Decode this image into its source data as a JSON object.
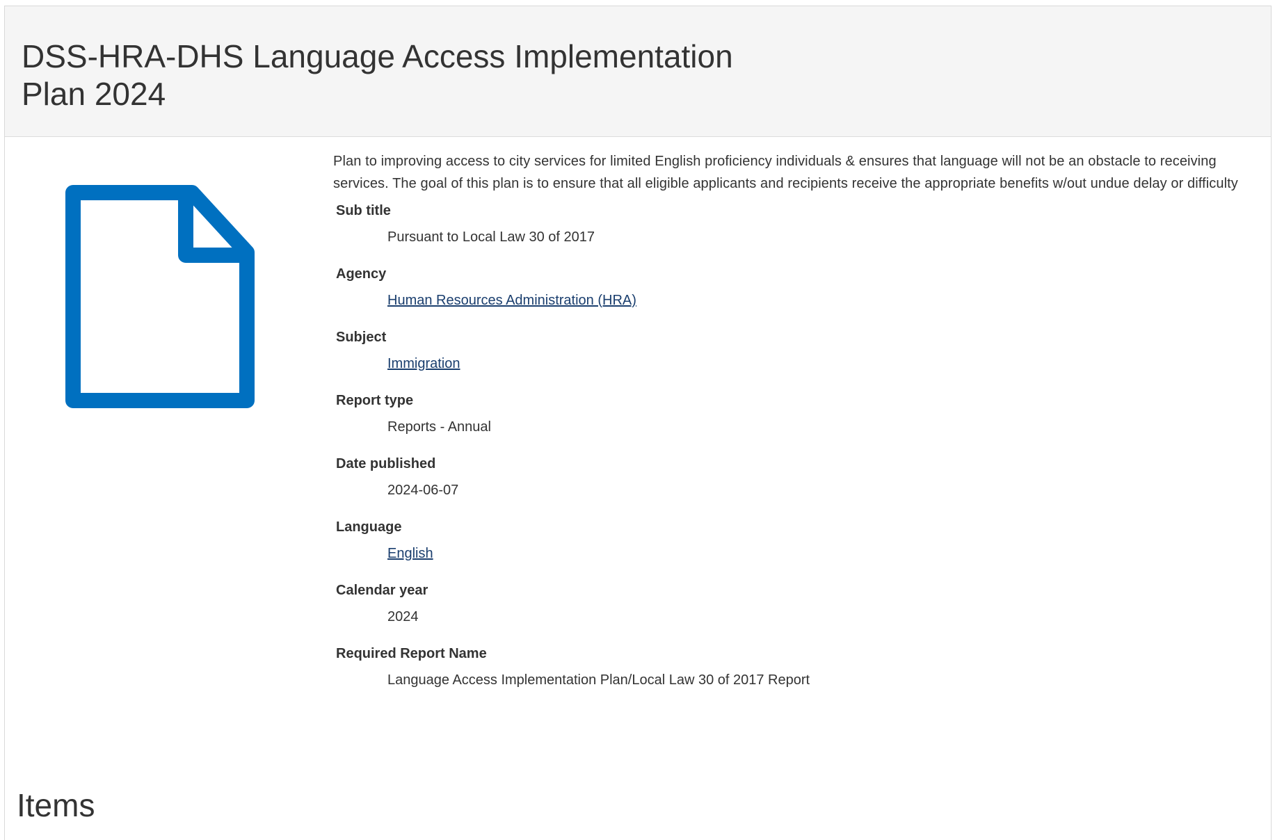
{
  "page": {
    "title": "DSS-HRA-DHS Language Access Implementation Plan 2024",
    "items_heading": "Items"
  },
  "document": {
    "icon": "document-icon",
    "icon_color": "#0070c0",
    "description": "Plan to improving access to city services for limited English proficiency individuals & ensures that language will not be an obstacle to receiving services. The goal of this plan is to ensure that all eligible applicants and recipients receive the appropriate benefits w/out undue delay or difficulty"
  },
  "metadata": {
    "sub_title": {
      "label": "Sub title",
      "value": "Pursuant to Local Law 30 of 2017"
    },
    "agency": {
      "label": "Agency",
      "value": "Human Resources Administration (HRA)"
    },
    "subject": {
      "label": "Subject",
      "value": "Immigration"
    },
    "report_type": {
      "label": "Report type",
      "value": "Reports - Annual"
    },
    "date_published": {
      "label": "Date published",
      "value": "2024-06-07"
    },
    "language": {
      "label": "Language",
      "value": "English"
    },
    "calendar_year": {
      "label": "Calendar year",
      "value": "2024"
    },
    "required_report_name": {
      "label": "Required Report Name",
      "value": "Language Access Implementation Plan/Local Law 30 of 2017 Report"
    }
  },
  "colors": {
    "header_bg": "#f5f5f5",
    "link": "#1a3e6e",
    "text": "#333333"
  }
}
